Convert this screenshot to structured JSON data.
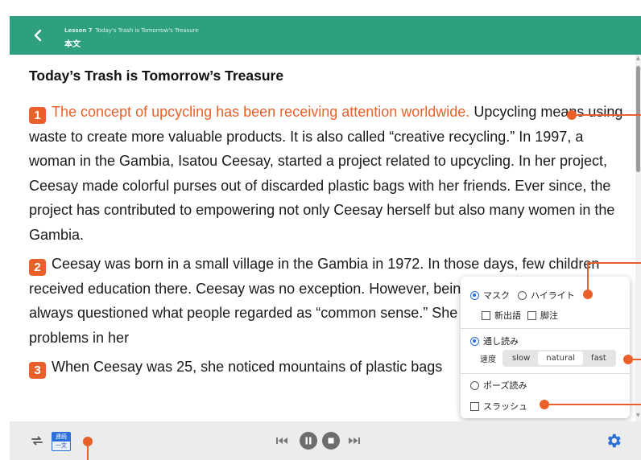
{
  "header": {
    "lesson_number": "Lesson 7",
    "lesson_title": "Today's Trash is Tomorrow's Treasure",
    "subtitle": "本文"
  },
  "content": {
    "title": "Today’s Trash is Tomorrow’s Treasure",
    "paragraphs": [
      {
        "number": "1",
        "highlight": "The concept of upcycling has been receiving attention worldwide.",
        "text": "Upcycling means using waste to create more valuable products.   It is also called “creative recycling.”   In 1997, a woman in the Gambia, Isatou Ceesay, started a project related to upcycling.   In her project, Ceesay made colorful purses out of discarded plastic bags with her friends.   Ever since, the project has contributed to empowering not only Ceesay herself but also many women in the Gambia."
      },
      {
        "number": "2",
        "text": "Ceesay was born in a small village in the Gambia in 1972.   In those days, few children received education there.   Ceesay was no exception.   However, being curious and active, she always questioned what people regarded as “common sense.”   She also wished to solve problems in her"
      },
      {
        "number": "3",
        "text": "When Ceesay was 25, she noticed mountains of plastic bags"
      }
    ]
  },
  "popover": {
    "mask_label": "マスク",
    "highlight_label": "ハイライト",
    "new_words_label": "新出語",
    "footnote_label": "脚注",
    "continuous_read_label": "通し読み",
    "speed_label": "速度",
    "speeds": [
      "slow",
      "natural",
      "fast"
    ],
    "selected_speed": "natural",
    "pause_read_label": "ポーズ読み",
    "slash_label": "スラッシュ"
  },
  "toolbar": {
    "mode_top": "連続",
    "mode_bottom": "一文"
  },
  "colors": {
    "header_bg": "#2ea07f",
    "accent_orange": "#e9602b",
    "radio_blue": "#2b6fd8",
    "toolbar_bg": "#ececec"
  }
}
